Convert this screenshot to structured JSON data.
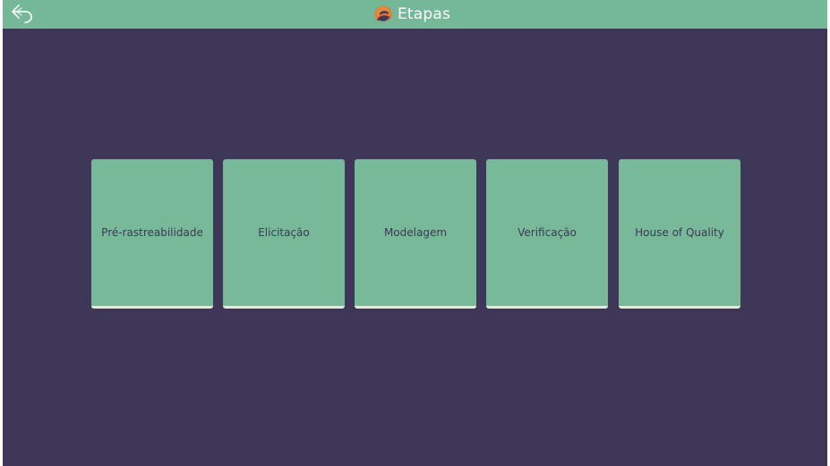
{
  "header": {
    "title": "Etapas",
    "back_icon": "back-arrow-icon",
    "logo_icon": "app-logo-icon",
    "bar_color": "#74b898"
  },
  "background_color": "#3f3758",
  "cards": [
    {
      "label": "Pré-rastreabilidade"
    },
    {
      "label": "Elicitação"
    },
    {
      "label": "Modelagem"
    },
    {
      "label": "Verificação"
    },
    {
      "label": "House of Quality"
    }
  ]
}
